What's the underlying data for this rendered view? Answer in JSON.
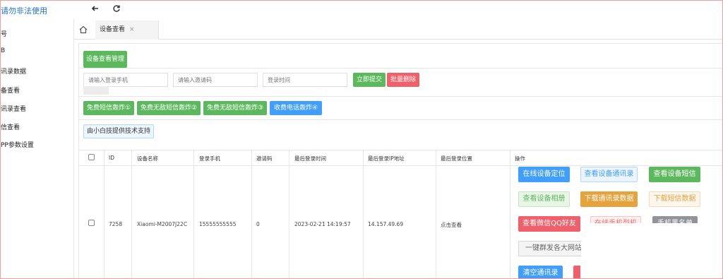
{
  "header": {
    "brand": "请勿非法使用",
    "back_icon": "arrow-left-icon",
    "refresh_icon": "refresh-icon"
  },
  "sidebar": {
    "items": [
      {
        "label": "号"
      },
      {
        "label": "B"
      },
      {
        "label": "讯录数据"
      },
      {
        "label": "备查看"
      },
      {
        "label": "讯录查看"
      },
      {
        "label": "信查看"
      },
      {
        "label": "PP参数设置"
      }
    ]
  },
  "tabs": {
    "home_icon": "home-icon",
    "active": {
      "label": "设备查看",
      "close": "×"
    }
  },
  "panel": {
    "title_button": "设备查看管理",
    "search": {
      "phone_placeholder": "请输入登录手机",
      "invite_placeholder": "请输入邀请码",
      "time_placeholder": "登录时间",
      "submit": "立即提交",
      "batch_delete": "批量删除"
    },
    "action_buttons": [
      "免费短信轰炸①",
      "免费无敌短信轰炸②",
      "免费无敌短信轰炸③",
      "收费电话轰炸④"
    ],
    "support_button": "由小白技提供技术支持"
  },
  "table": {
    "headers": [
      "ID",
      "设备名称",
      "登录手机",
      "邀请码",
      "最后登录时间",
      "最后登录IP地址",
      "最后登录位置",
      "操作"
    ],
    "rows": [
      {
        "id": "7258",
        "device": "Xiaomi-M2007J22C",
        "phone": "15555555555",
        "invite": "0",
        "last_login": "2023-02-21 14:19:57",
        "ip": "14.157.49.69",
        "location": "点击查看"
      }
    ],
    "ops": {
      "online_location": "在线设备定位",
      "view_contacts": "查看设备通讯录",
      "view_sms": "查看设备短信",
      "view_album": "查看设备相册",
      "download_contacts": "下载通讯录数据",
      "download_sms": "下载短信数据",
      "view_qq": "查看微信QQ好友",
      "phone_brand": "在线手机型机",
      "phone_blacklist": "手机黑名单",
      "mass_send": "一键群发各大网站",
      "clear_contacts": "清空通讯录"
    }
  }
}
